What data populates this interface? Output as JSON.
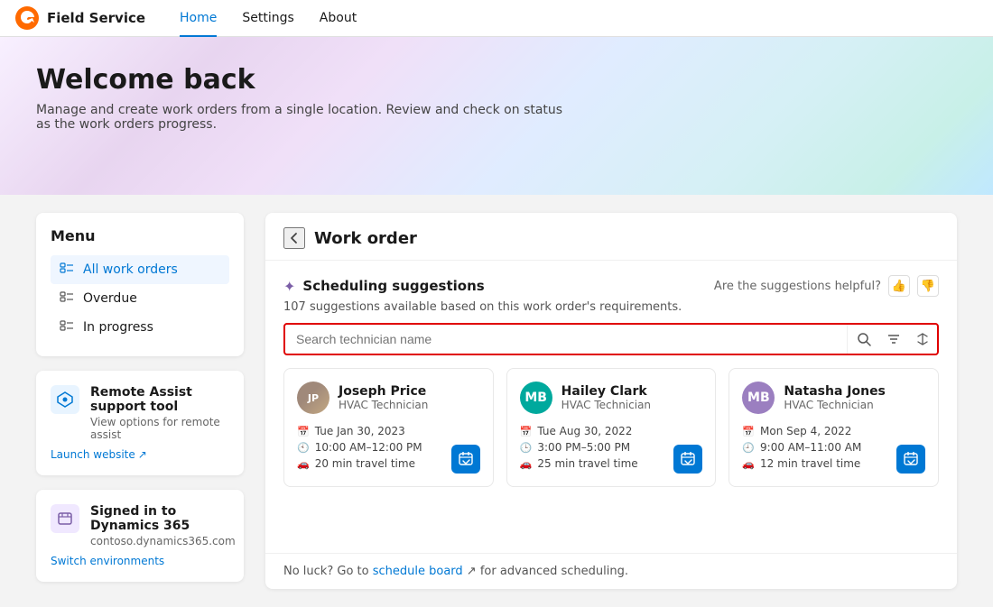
{
  "nav": {
    "app_icon": "🟠",
    "title": "Field Service",
    "items": [
      {
        "label": "Home",
        "active": true
      },
      {
        "label": "Settings",
        "active": false
      },
      {
        "label": "About",
        "active": false
      }
    ]
  },
  "hero": {
    "title": "Welcome back",
    "subtitle": "Manage and create work orders from a single location. Review and check on status as the work orders progress."
  },
  "menu": {
    "title": "Menu",
    "items": [
      {
        "label": "All work orders",
        "active": true
      },
      {
        "label": "Overdue",
        "active": false
      },
      {
        "label": "In progress",
        "active": false
      }
    ]
  },
  "remote_assist": {
    "title": "Remote Assist support tool",
    "desc": "View options for remote assist",
    "link": "Launch website"
  },
  "dynamics": {
    "title": "Signed in to Dynamics 365",
    "desc": "contoso.dynamics365.com",
    "link": "Switch environments"
  },
  "panel": {
    "back_label": "←",
    "title": "Work order",
    "scheduling_icon": "✦",
    "scheduling_title": "Scheduling suggestions",
    "scheduling_count": "107 suggestions available based on this work order's requirements.",
    "helpful_label": "Are the suggestions helpful?",
    "search_placeholder": "Search technician name",
    "technicians": [
      {
        "name": "Joseph Price",
        "role": "HVAC Technician",
        "date": "Tue Jan 30, 2023",
        "time": "10:00 AM–12:00 PM",
        "travel": "20 min travel time",
        "avatar_type": "photo",
        "initials": "JP"
      },
      {
        "name": "Hailey Clark",
        "role": "HVAC Technician",
        "date": "Tue Aug 30, 2022",
        "time": "3:00 PM–5:00 PM",
        "travel": "25 min travel time",
        "avatar_type": "teal",
        "initials": "MB"
      },
      {
        "name": "Natasha Jones",
        "role": "HVAC Technician",
        "date": "Mon Sep 4, 2022",
        "time": "9:00 AM–11:00 AM",
        "travel": "12 min travel time",
        "avatar_type": "purple",
        "initials": "MB"
      }
    ],
    "footer_prefix": "No luck? Go to ",
    "footer_link": "schedule board",
    "footer_suffix": " for advanced scheduling."
  }
}
